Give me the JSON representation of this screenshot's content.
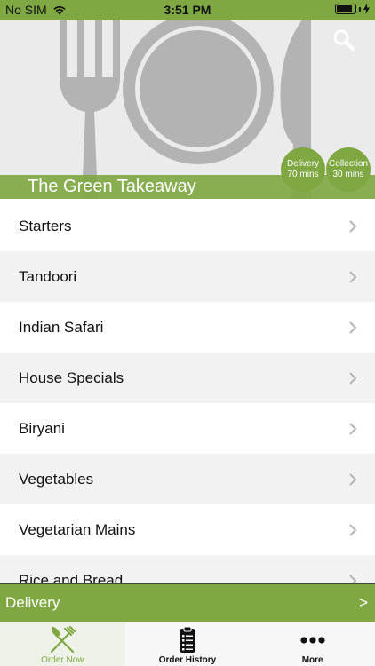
{
  "status_bar": {
    "carrier": "No SIM",
    "time": "3:51 PM",
    "battery_level": 0.85
  },
  "hero": {
    "restaurant_name": "The Green Takeaway",
    "delivery_badge": {
      "title": "Delivery",
      "value": "70 mins"
    },
    "collection_badge": {
      "title": "Collection",
      "value": "30 mins"
    },
    "search_icon": "search-icon"
  },
  "menu": {
    "categories": [
      {
        "label": "Starters"
      },
      {
        "label": "Tandoori"
      },
      {
        "label": "Indian Safari"
      },
      {
        "label": "House Specials"
      },
      {
        "label": "Biryani"
      },
      {
        "label": "Vegetables"
      },
      {
        "label": "Vegetarian Mains"
      },
      {
        "label": "Rice and Bread"
      }
    ]
  },
  "order_type_bar": {
    "label": "Delivery",
    "arrow": ">"
  },
  "tabs": [
    {
      "label": "Order Now",
      "icon": "fork-knife-icon",
      "active": true
    },
    {
      "label": "Order History",
      "icon": "clipboard-icon",
      "active": false
    },
    {
      "label": "More",
      "icon": "ellipsis-icon",
      "active": false
    }
  ],
  "colors": {
    "accent": "#7fa843",
    "hero_background": "#ebebeb",
    "illustration": "#b3b3b3",
    "divider": "#3e4a2c"
  }
}
